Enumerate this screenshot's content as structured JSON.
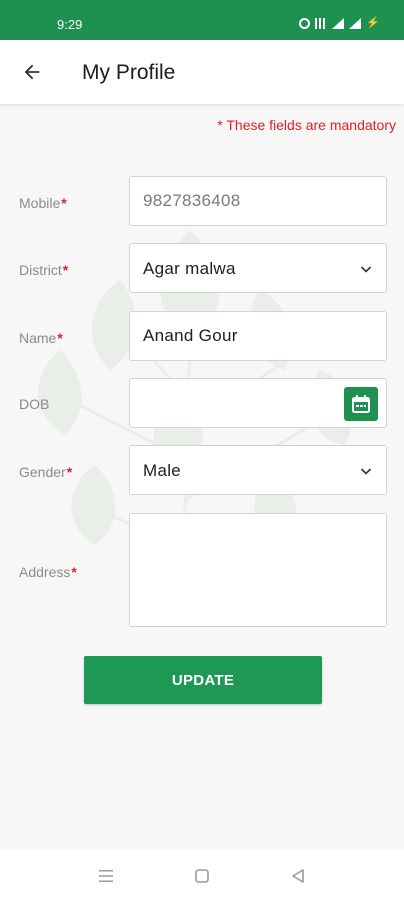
{
  "status_bar": {
    "time": "9:29",
    "battery_glyph": "⚡",
    "icons": [
      "alarm-icon",
      "vibrate-bars-icon",
      "signal-icon",
      "signal-icon",
      "battery-charging-icon"
    ]
  },
  "app_bar": {
    "title": "My Profile",
    "back_icon": "arrow-left-icon"
  },
  "form": {
    "mandatory_note": "* These fields are mandatory",
    "required_marker": "*",
    "mobile": {
      "label": "Mobile",
      "value": "9827836408"
    },
    "district": {
      "label": "District",
      "value": "Agar malwa"
    },
    "name": {
      "label": "Name",
      "value": "Anand Gour"
    },
    "dob": {
      "label": "DOB",
      "value": ""
    },
    "gender": {
      "label": "Gender",
      "value": "Male"
    },
    "address": {
      "label": "Address",
      "value": ""
    }
  },
  "update_button": {
    "label": "UPDATE"
  },
  "nav_bar": {
    "icons": [
      "menu-icon",
      "home-square-icon",
      "back-triangle-icon"
    ]
  },
  "colors": {
    "primary": "#1e9150",
    "required": "#e52020",
    "label": "#8a8a8a",
    "background": "#f6f7f6"
  }
}
